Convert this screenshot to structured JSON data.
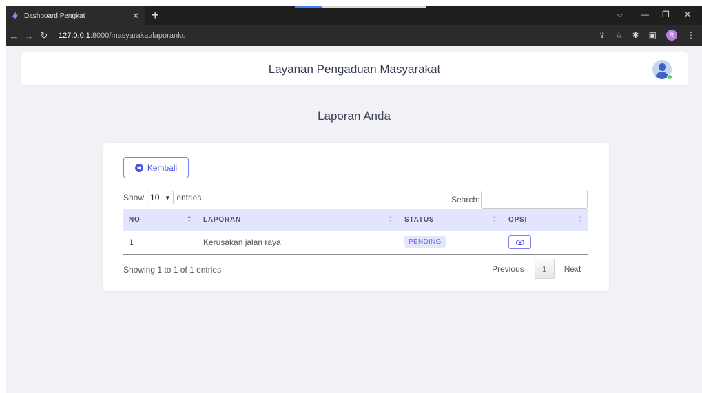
{
  "browser": {
    "tab_title": "Dashboard Pengkat",
    "url_host": "127.0.0.1",
    "url_path": ":8000/masyarakat/laporanku",
    "profile_initial": "R"
  },
  "header": {
    "title": "Layanan Pengaduan Masyarakat"
  },
  "page": {
    "title": "Laporan Anda"
  },
  "card": {
    "back_label": "Kembali",
    "show_label": "Show",
    "entries_value": "10",
    "entries_label": "entries",
    "search_label": "Search:",
    "columns": [
      "NO",
      "LAPORAN",
      "STATUS",
      "OPSI"
    ],
    "rows": [
      {
        "no": "1",
        "laporan": "Kerusakan jalan raya",
        "status": "PENDING"
      }
    ],
    "info": "Showing 1 to 1 of 1 entries",
    "pagination": {
      "previous": "Previous",
      "page": "1",
      "next": "Next"
    }
  },
  "colors": {
    "accent": "#4c55d9",
    "header_bg": "#e3e4fd",
    "badge_bg": "#e5e6fc"
  }
}
